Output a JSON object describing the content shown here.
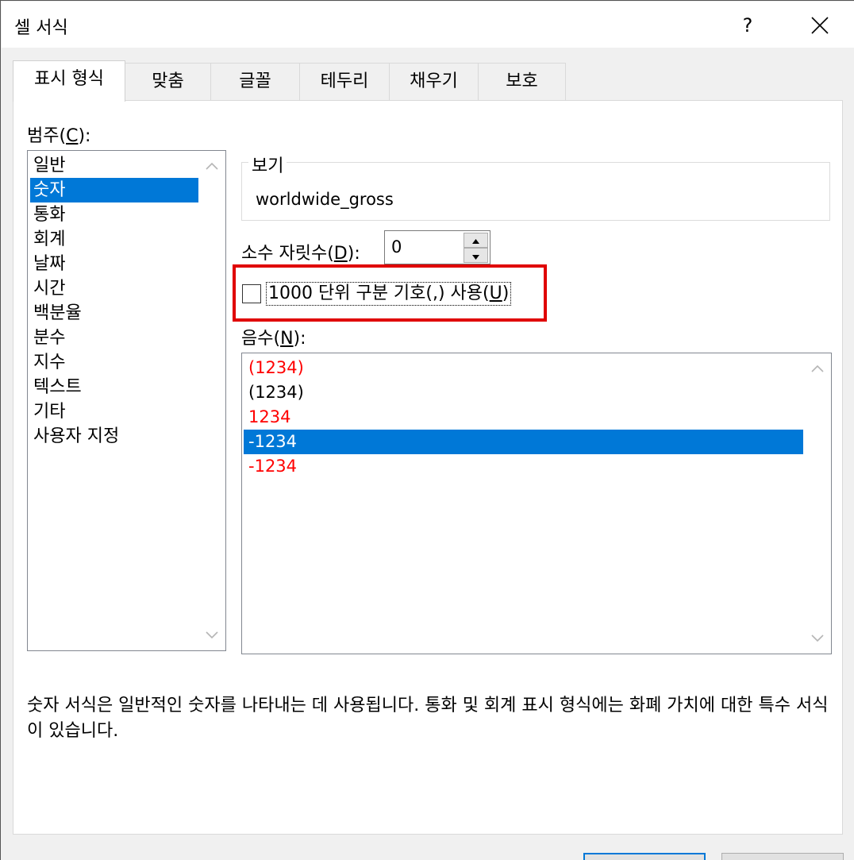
{
  "window": {
    "title": "셀 서식",
    "help_label": "?"
  },
  "tabs": [
    {
      "label": "표시 형식",
      "active": true
    },
    {
      "label": "맞춤"
    },
    {
      "label": "글꼴"
    },
    {
      "label": "테두리"
    },
    {
      "label": "채우기"
    },
    {
      "label": "보호"
    }
  ],
  "category": {
    "label_prefix": "범주(",
    "label_mnemonic": "C",
    "label_suffix": "):",
    "items": [
      "일반",
      "숫자",
      "통화",
      "회계",
      "날짜",
      "시간",
      "백분율",
      "분수",
      "지수",
      "텍스트",
      "기타",
      "사용자 지정"
    ],
    "selected": "숫자"
  },
  "preview": {
    "legend": "보기",
    "value": "worldwide_gross"
  },
  "decimal": {
    "label_prefix": "소수 자릿수(",
    "label_mnemonic": "D",
    "label_suffix": "):",
    "value": "0"
  },
  "thousands": {
    "label_prefix": "1000 단위 구분 기호(,) 사용(",
    "label_mnemonic": "U",
    "label_suffix": ")",
    "checked": false
  },
  "negative": {
    "label_prefix": "음수(",
    "label_mnemonic": "N",
    "label_suffix": "):",
    "items": [
      {
        "text": "(1234)",
        "color": "#ff0000"
      },
      {
        "text": "(1234)",
        "color": "#000000"
      },
      {
        "text": "1234",
        "color": "#ff0000"
      },
      {
        "text": "-1234",
        "color": "#000000",
        "selected": true
      },
      {
        "text": "-1234",
        "color": "#ff0000"
      }
    ]
  },
  "description": "숫자 서식은 일반적인 숫자를 나타내는 데 사용됩니다. 통화 및 회계 표시 형식에는 화폐 가치에 대한 특수 서식이 있습니다.",
  "colors": {
    "selection": "#0078d7",
    "highlight_box": "#e00000",
    "negative_red": "#ff0000"
  }
}
